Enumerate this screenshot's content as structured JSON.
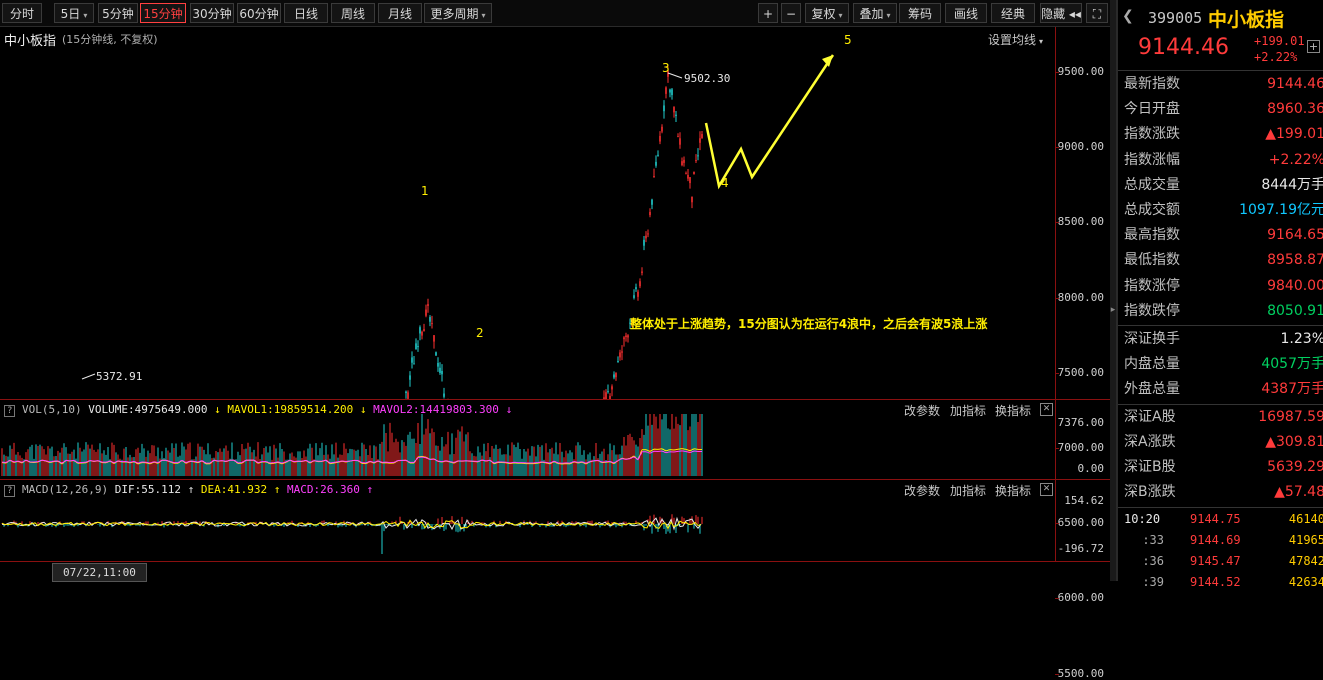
{
  "toolbar": {
    "left": [
      {
        "label": "分时",
        "active": false,
        "dropdown": false
      },
      {
        "label": "5日",
        "active": false,
        "dropdown": true
      },
      {
        "label": "5分钟",
        "active": false,
        "dropdown": false
      },
      {
        "label": "15分钟",
        "active": true,
        "dropdown": false
      },
      {
        "label": "30分钟",
        "active": false,
        "dropdown": false
      },
      {
        "label": "60分钟",
        "active": false,
        "dropdown": false
      },
      {
        "label": "日线",
        "active": false,
        "dropdown": false
      },
      {
        "label": "周线",
        "active": false,
        "dropdown": false
      },
      {
        "label": "月线",
        "active": false,
        "dropdown": false
      },
      {
        "label": "更多周期",
        "active": false,
        "dropdown": true
      }
    ],
    "right": [
      {
        "label": "+"
      },
      {
        "label": "−"
      },
      {
        "label": "复权",
        "dropdown": true
      },
      {
        "label": "叠加",
        "dropdown": true
      },
      {
        "label": "筹码"
      },
      {
        "label": "画线"
      },
      {
        "label": "经典"
      },
      {
        "label": "隐藏 ◂◂"
      },
      {
        "label": "⛶"
      }
    ]
  },
  "main": {
    "title": "中小板指",
    "subtitle": "(15分钟线, 不复权)",
    "settings_label": "设置均线",
    "y_ticks": [
      "9500.00",
      "9000.00",
      "8500.00",
      "8000.00",
      "7500.00",
      "7000.00",
      "6500.00",
      "6000.00",
      "5500.00"
    ],
    "high_label": "9502.30",
    "low_label": "5372.91",
    "wave_labels": [
      "1",
      "2",
      "3",
      "4",
      "5"
    ],
    "annotation": "整体处于上涨趋势，15分图认为在运行4浪中，之后会有波5浪上涨"
  },
  "volume": {
    "header": {
      "name": "VOL(5,10)",
      "volume": "VOLUME:4975649.000",
      "ma1": "MAVOL1:19859514.200",
      "ma2": "MAVOL2:14419803.300"
    },
    "buttons": [
      "改参数",
      "加指标",
      "换指标"
    ],
    "y_ticks": [
      "7376.00",
      "0.00"
    ]
  },
  "macd": {
    "header": {
      "name": "MACD(12,26,9)",
      "dif": "DIF:55.112",
      "dea": "DEA:41.932",
      "macd": "MACD:26.360"
    },
    "buttons": [
      "改参数",
      "加指标",
      "换指标"
    ],
    "y_ticks": [
      "154.62",
      "-196.72"
    ]
  },
  "timebar": {
    "cursor_label": "07/22,11:00"
  },
  "quote": {
    "code": "399005",
    "name": "中小板指",
    "price": "9144.46",
    "change": "+199.01",
    "change_pct": "+2.22%",
    "rows": [
      {
        "label": "最新指数",
        "value": "9144.46",
        "color": "red"
      },
      {
        "label": "今日开盘",
        "value": "8960.36",
        "color": "red"
      },
      {
        "label": "指数涨跌",
        "value": "▲199.01",
        "color": "red"
      },
      {
        "label": "指数涨幅",
        "value": "+2.22%",
        "color": "red"
      },
      {
        "label": "总成交量",
        "value": "8444万手",
        "color": "white"
      },
      {
        "label": "总成交额",
        "value": "1097.19亿元",
        "color": "cyan"
      },
      {
        "label": "最高指数",
        "value": "9164.65",
        "color": "red"
      },
      {
        "label": "最低指数",
        "value": "8958.87",
        "color": "red"
      },
      {
        "label": "指数涨停",
        "value": "9840.00",
        "color": "red"
      },
      {
        "label": "指数跌停",
        "value": "8050.91",
        "color": "green"
      }
    ],
    "rows2": [
      {
        "label": "深证换手",
        "value": "1.23%",
        "color": "white"
      },
      {
        "label": "内盘总量",
        "value": "4057万手",
        "color": "green"
      },
      {
        "label": "外盘总量",
        "value": "4387万手",
        "color": "red"
      }
    ],
    "rows3": [
      {
        "label": "深证A股",
        "value": "16987.59",
        "color": "red"
      },
      {
        "label": "深A涨跌",
        "value": "▲309.81",
        "color": "red"
      },
      {
        "label": "深证B股",
        "value": "5639.29",
        "color": "red"
      },
      {
        "label": "深B涨跌",
        "value": "▲57.48",
        "color": "red"
      }
    ],
    "ticks": [
      {
        "time": "10:20",
        "price": "9144.75",
        "vol": "46140"
      },
      {
        "time": ":33",
        "price": "9144.69",
        "vol": "41965"
      },
      {
        "time": ":36",
        "price": "9145.47",
        "vol": "47842"
      },
      {
        "time": ":39",
        "price": "9144.52",
        "vol": "42634"
      }
    ]
  }
}
